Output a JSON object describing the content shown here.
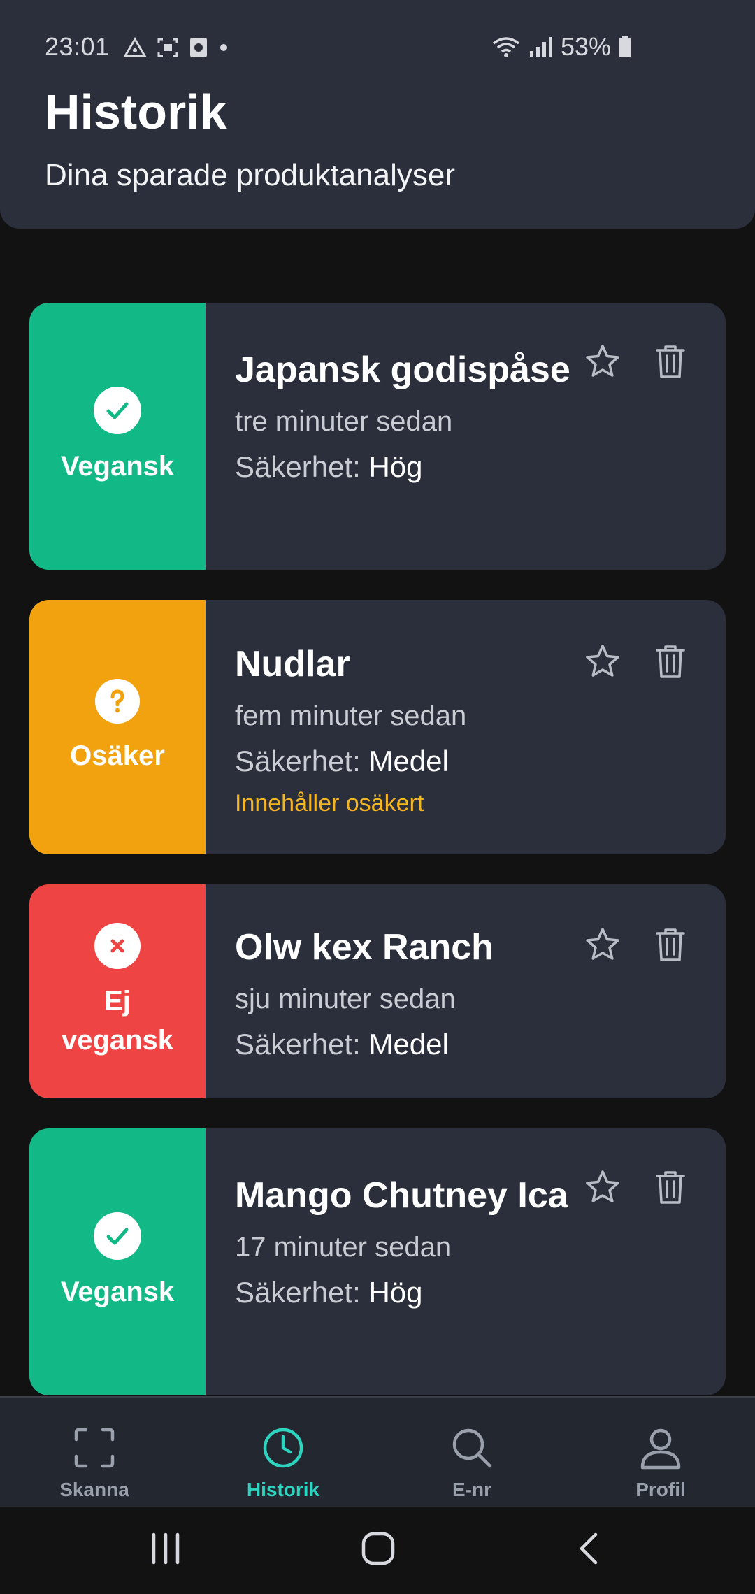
{
  "status_bar": {
    "time": "23:01",
    "battery": "53%",
    "icons": [
      "triangle-alert-icon",
      "screenshot-icon",
      "camera-icon",
      "dot-icon",
      "wifi-icon",
      "signal-icon",
      "battery-icon"
    ]
  },
  "header": {
    "title": "Historik",
    "subtitle": "Dina sparade produktanalyser"
  },
  "cards": [
    {
      "status": "Vegansk",
      "status_color": "#12b886",
      "status_icon": "check-icon",
      "title": "Japansk godispåse",
      "time": "tre minuter sedan",
      "security_label": "Säkerhet:",
      "security_value": "Hög",
      "warning": ""
    },
    {
      "status": "Osäker",
      "status_color": "#f2a20f",
      "status_icon": "question-icon",
      "title": "Nudlar",
      "time": "fem minuter sedan",
      "security_label": "Säkerhet:",
      "security_value": "Medel",
      "warning": "Innehåller osäkert"
    },
    {
      "status": "Ej vegansk",
      "status_color": "#ef4444",
      "status_icon": "x-icon",
      "title": "Olw kex Ranch",
      "time": "sju minuter sedan",
      "security_label": "Säkerhet:",
      "security_value": "Medel",
      "warning": ""
    },
    {
      "status": "Vegansk",
      "status_color": "#12b886",
      "status_icon": "check-icon",
      "title": "Mango Chutney Ica",
      "time": "17 minuter sedan",
      "security_label": "Säkerhet:",
      "security_value": "Hög",
      "warning": ""
    }
  ],
  "bottom_nav": [
    {
      "label": "Skanna",
      "icon": "scan-icon",
      "active": false
    },
    {
      "label": "Historik",
      "icon": "clock-icon",
      "active": true
    },
    {
      "label": "E-nr",
      "icon": "search-icon",
      "active": false
    },
    {
      "label": "Profil",
      "icon": "user-icon",
      "active": false
    }
  ],
  "colors": {
    "accent": "#2dd4bf",
    "vegan": "#12b886",
    "uncertain": "#f2a20f",
    "not_vegan": "#ef4444",
    "warning_text": "#f5b621"
  }
}
